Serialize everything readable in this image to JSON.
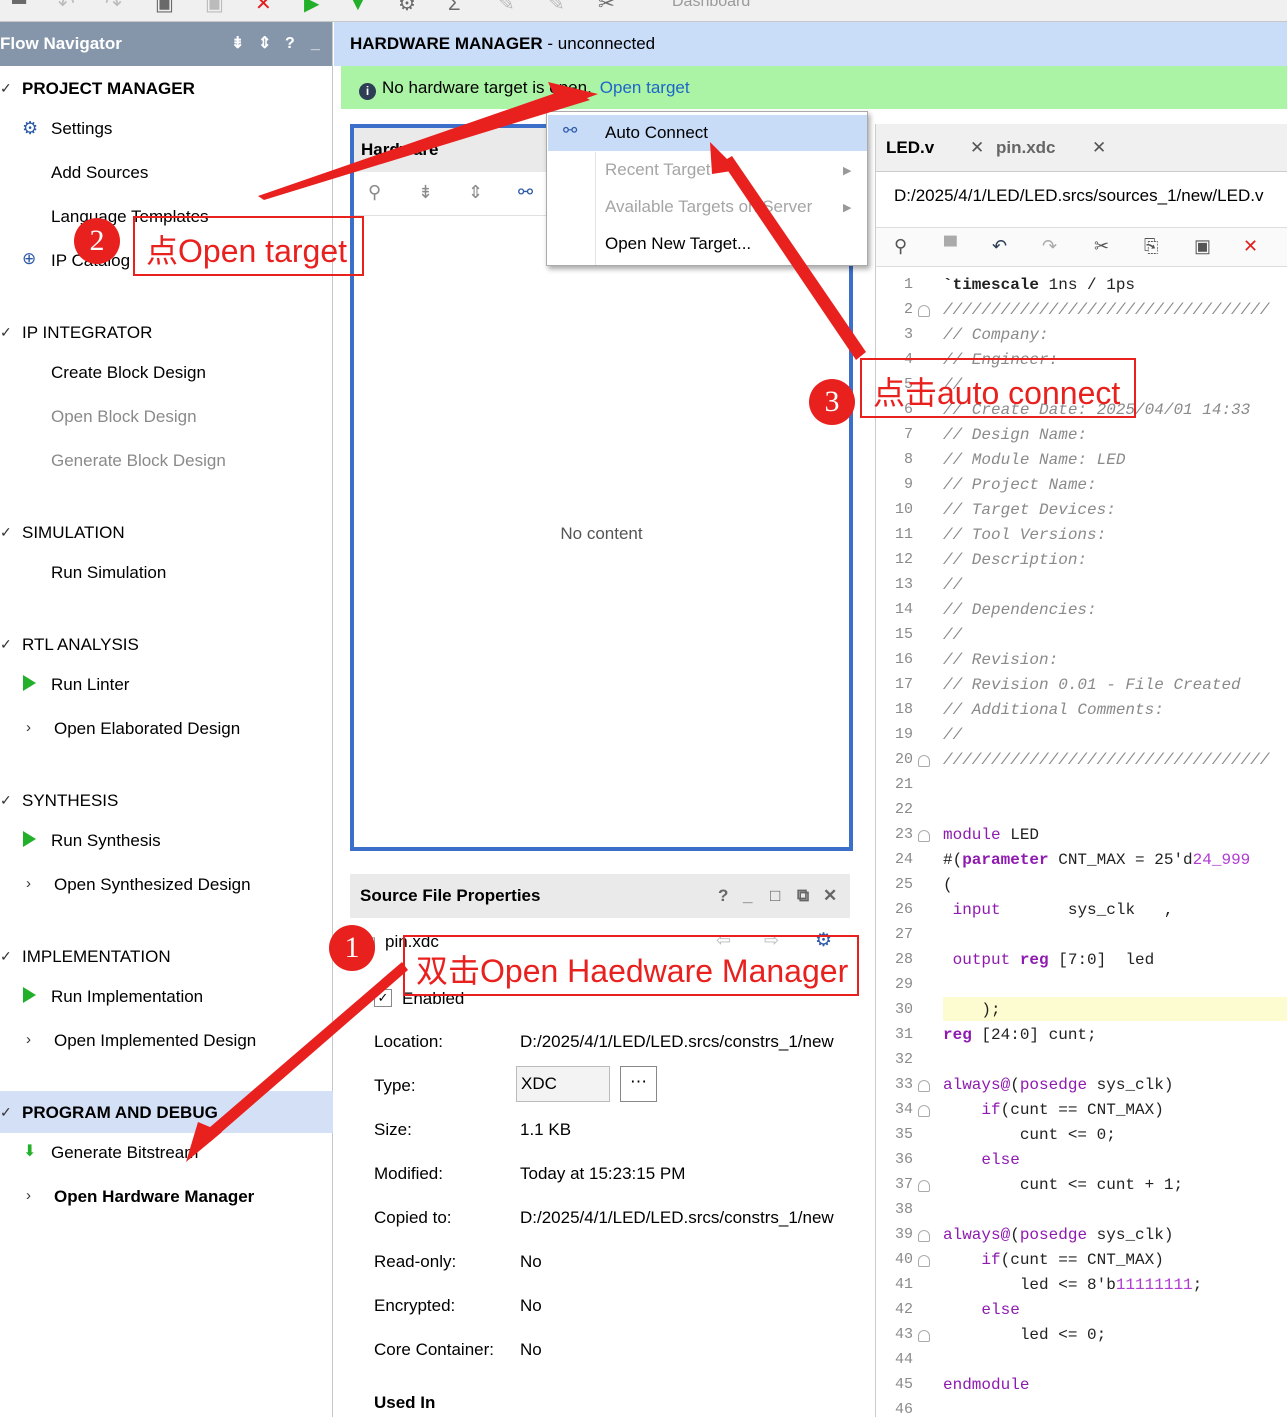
{
  "toolbar": {
    "dashboard_label": "Dashboard"
  },
  "flow_nav": {
    "title": "Flow Navigator",
    "sections": {
      "project_manager": "PROJECT MANAGER",
      "ip_integrator": "IP INTEGRATOR",
      "simulation": "SIMULATION",
      "rtl_analysis": "RTL ANALYSIS",
      "synthesis": "SYNTHESIS",
      "implementation": "IMPLEMENTATION",
      "program_debug": "PROGRAM AND DEBUG"
    },
    "items": {
      "settings": "Settings",
      "add_sources": "Add Sources",
      "language_templates": "Language Templates",
      "ip_catalog": "IP Catalog",
      "create_block": "Create Block Design",
      "open_block": "Open Block Design",
      "generate_block": "Generate Block Design",
      "run_simulation": "Run Simulation",
      "run_linter": "Run Linter",
      "open_elaborated": "Open Elaborated Design",
      "run_synthesis": "Run Synthesis",
      "open_synthesized": "Open Synthesized Design",
      "run_implementation": "Run Implementation",
      "open_implemented": "Open Implemented Design",
      "generate_bitstream": "Generate Bitstream",
      "open_hw_manager": "Open Hardware Manager"
    }
  },
  "hw_manager": {
    "title": "HARDWARE MANAGER",
    "status": " - unconnected",
    "info_text": "No hardware target is open.",
    "info_link": "Open target"
  },
  "hardware_panel": {
    "title": "Hardware",
    "empty": "No content"
  },
  "menu": {
    "auto_connect": "Auto Connect",
    "recent_target": "Recent Target",
    "available_targets": "Available Targets on Server",
    "open_new_target": "Open New Target..."
  },
  "source_props": {
    "title": "Source File Properties",
    "file": "pin.xdc",
    "enabled": "Enabled",
    "labels": {
      "location": "Location:",
      "type": "Type:",
      "size": "Size:",
      "modified": "Modified:",
      "copied_to": "Copied to:",
      "read_only": "Read-only:",
      "encrypted": "Encrypted:",
      "core_container": "Core Container:",
      "used_in": "Used In"
    },
    "values": {
      "location": "D:/2025/4/1/LED/LED.srcs/constrs_1/new",
      "type": "XDC",
      "size": "1.1 KB",
      "modified": "Today at 15:23:15 PM",
      "copied_to": "D:/2025/4/1/LED/LED.srcs/constrs_1/new",
      "read_only": "No",
      "encrypted": "No",
      "core_container": "No"
    }
  },
  "editor": {
    "tabs": [
      "LED.v",
      "pin.xdc"
    ],
    "path": "D:/2025/4/1/LED/LED.srcs/sources_1/new/LED.v",
    "lines": [
      "`timescale 1ns / 1ps",
      "//////////////////////////////////",
      "// Company:",
      "// Engineer:",
      "//",
      "// Create Date: 2025/04/01 14:33",
      "// Design Name:",
      "// Module Name: LED",
      "// Project Name:",
      "// Target Devices:",
      "// Tool Versions:",
      "// Description:",
      "//",
      "// Dependencies:",
      "//",
      "// Revision:",
      "// Revision 0.01 - File Created",
      "// Additional Comments:",
      "//",
      "//////////////////////////////////",
      "",
      "",
      "module LED",
      "#(parameter CNT_MAX = 25'd24_999",
      "(",
      " input       sys_clk   ,",
      "",
      " output reg [7:0]  led",
      "",
      "    );",
      "reg [24:0] cunt;",
      "",
      "always@(posedge sys_clk)",
      "    if(cunt == CNT_MAX)",
      "        cunt <= 0;",
      "    else",
      "        cunt <= cunt + 1;",
      "",
      "always@(posedge sys_clk)",
      "    if(cunt == CNT_MAX)",
      "        led <= 8'b11111111;",
      "    else",
      "        led <= 0;",
      "",
      "endmodule",
      ""
    ]
  },
  "annotations": {
    "step1_num": "1",
    "step1_text": "双击Open Haedware Manager",
    "step2_num": "2",
    "step2_text": "点Open target",
    "step3_num": "3",
    "step3_text": "点击auto connect"
  },
  "colors": {
    "accent_red": "#e8211f",
    "nav_header": "#8596ab",
    "info_green": "#acf4a5",
    "panel_blue": "#3c6fc9"
  }
}
